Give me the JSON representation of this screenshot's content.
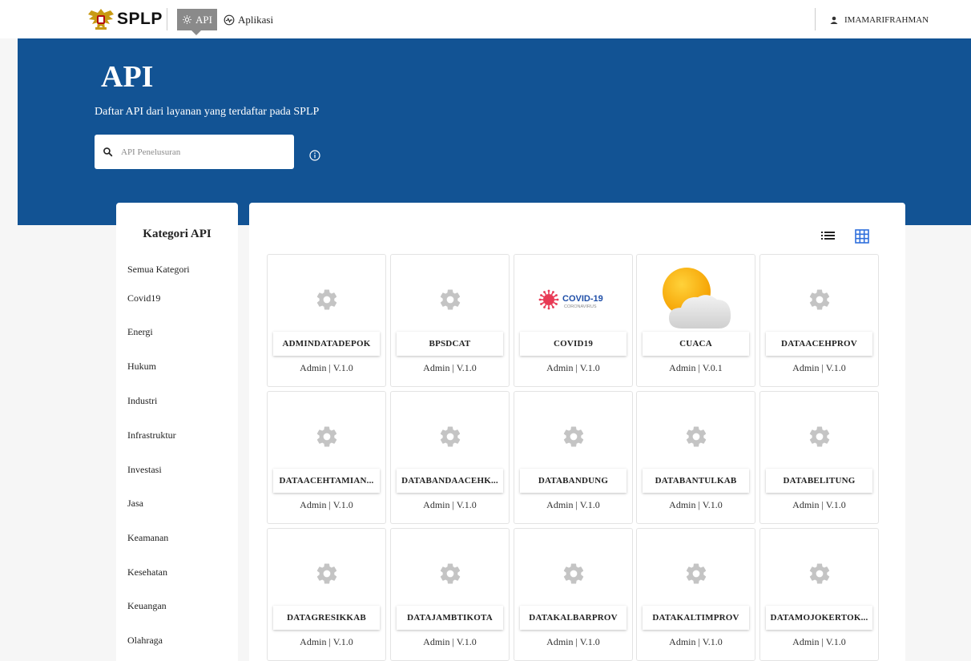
{
  "nav": {
    "brand": "SPLP",
    "api_label": "API",
    "app_label": "Aplikasi",
    "user": "IMAMARIFRAHMAN",
    "logo_icon": "garuda-emblem-icon"
  },
  "hero": {
    "title": "API",
    "subtitle": "Daftar API dari layanan yang terdaftar pada SPLP",
    "search_placeholder": "API Penelusuran",
    "bg_color": "#125394"
  },
  "sidebar": {
    "title": "Kategori API",
    "categories": [
      "Semua Kategori",
      "Covid19",
      "Energi",
      "Hukum",
      "Industri",
      "Infrastruktur",
      "Investasi",
      "Jasa",
      "Keamanan",
      "Kesehatan",
      "Keuangan",
      "Olahraga"
    ]
  },
  "view_toggle": {
    "list_icon": "list-view-icon",
    "grid_icon": "grid-view-icon",
    "active": "grid",
    "active_color": "#2f6fdc"
  },
  "cards": [
    {
      "name": "ADMINDATADEPOK",
      "meta": "Admin | V.1.0",
      "icon": "gear-icon"
    },
    {
      "name": "BPSDCAT",
      "meta": "Admin | V.1.0",
      "icon": "gear-icon"
    },
    {
      "name": "COVID19",
      "meta": "Admin | V.1.0",
      "icon": "covid-logo",
      "logo_text": "COVID-19",
      "logo_sub": "CORONAVIRUS"
    },
    {
      "name": "CUACA",
      "meta": "Admin | V.0.1",
      "icon": "weather-sun-cloud-icon"
    },
    {
      "name": "DATAACEHPROV",
      "meta": "Admin | V.1.0",
      "icon": "gear-icon"
    },
    {
      "name": "DATAACEHTAMIAN...",
      "meta": "Admin | V.1.0",
      "icon": "gear-icon"
    },
    {
      "name": "DATABANDAACEHK...",
      "meta": "Admin | V.1.0",
      "icon": "gear-icon"
    },
    {
      "name": "DATABANDUNG",
      "meta": "Admin | V.1.0",
      "icon": "gear-icon"
    },
    {
      "name": "DATABANTULKAB",
      "meta": "Admin | V.1.0",
      "icon": "gear-icon"
    },
    {
      "name": "DATABELITUNG",
      "meta": "Admin | V.1.0",
      "icon": "gear-icon"
    },
    {
      "name": "DATAGRESIKKAB",
      "meta": "Admin | V.1.0",
      "icon": "gear-icon"
    },
    {
      "name": "DATAJAMBTIKOTA",
      "meta": "Admin | V.1.0",
      "icon": "gear-icon"
    },
    {
      "name": "DATAKALBARPROV",
      "meta": "Admin | V.1.0",
      "icon": "gear-icon"
    },
    {
      "name": "DATAKALTIMPROV",
      "meta": "Admin | V.1.0",
      "icon": "gear-icon"
    },
    {
      "name": "DATAMOJOKERTOK...",
      "meta": "Admin | V.1.0",
      "icon": "gear-icon"
    }
  ]
}
